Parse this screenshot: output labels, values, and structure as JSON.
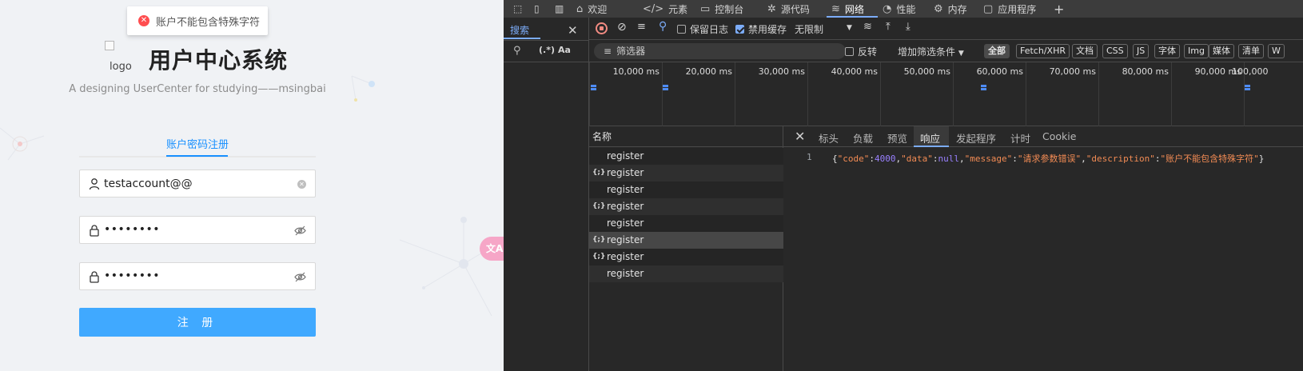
{
  "app": {
    "toast": "账户不能包含特殊字符",
    "logo_alt": "logo",
    "title": "用户中心系统",
    "subtitle": "A designing UserCenter for studying——msingbai",
    "tab": "账户密码注册",
    "account_value": "testaccount@@",
    "password_mask": "••••••••",
    "confirm_mask": "••••••••",
    "register_label": "注 册",
    "translate_fab": "文A"
  },
  "devtools": {
    "tabs": [
      "欢迎",
      "元素",
      "控制台",
      "源代码",
      "网络",
      "性能",
      "内存",
      "应用程序"
    ],
    "active_tab": "网络",
    "search_tab": "搜索",
    "regex_label": "(.*)",
    "case_label": "Aa",
    "toolbar": {
      "preserve_log": "保留日志",
      "disable_cache": "禁用缓存",
      "throttle": "无限制"
    },
    "filter": {
      "placeholder": "筛选器",
      "invert": "反转",
      "more_filters": "增加筛选条件",
      "types": [
        "全部",
        "Fetch/XHR",
        "文档",
        "CSS",
        "JS",
        "字体",
        "Img",
        "媒体",
        "清单",
        "W"
      ]
    },
    "timeline": [
      "10,000 ms",
      "20,000 ms",
      "30,000 ms",
      "40,000 ms",
      "50,000 ms",
      "60,000 ms",
      "70,000 ms",
      "80,000 ms",
      "90,000 ms",
      "100,000"
    ],
    "names_header": "名称",
    "requests": [
      {
        "name": "register",
        "xhr": false
      },
      {
        "name": "register",
        "xhr": true
      },
      {
        "name": "register",
        "xhr": false
      },
      {
        "name": "register",
        "xhr": true
      },
      {
        "name": "register",
        "xhr": false
      },
      {
        "name": "register",
        "xhr": true,
        "selected": true
      },
      {
        "name": "register",
        "xhr": true
      },
      {
        "name": "register",
        "xhr": false
      }
    ],
    "detail_tabs": [
      "标头",
      "负载",
      "预览",
      "响应",
      "发起程序",
      "计时",
      "Cookie"
    ],
    "active_detail_tab": "响应",
    "response": {
      "line_number": "1",
      "code": "4000",
      "data": "null",
      "message": "请求参数错误",
      "description": "账户不能包含特殊字符"
    }
  }
}
